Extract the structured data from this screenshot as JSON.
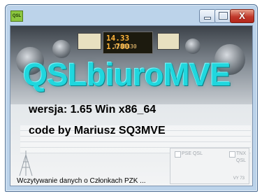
{
  "window": {
    "icon_label": "QSL",
    "buttons": {
      "minimize": "",
      "maximize": "",
      "close": "X"
    }
  },
  "splash": {
    "background": {
      "radio_display_freq": "14.33 1.700",
      "radio_display_sub": "3238330"
    },
    "title": "QSLbiuroMVE",
    "version_text": "wersja: 1.65 Win x86_64",
    "author_text": "code by Mariusz SQ3MVE",
    "card_labels": {
      "psk_qsl": "PSE QSL",
      "tnx_qsl": "TNX QSL",
      "vy73": "VY 73"
    },
    "status_text": "Wczytywanie danych o Członkach PZK ..."
  },
  "colors": {
    "title": "#20d7de",
    "close_button": "#c0392b"
  }
}
